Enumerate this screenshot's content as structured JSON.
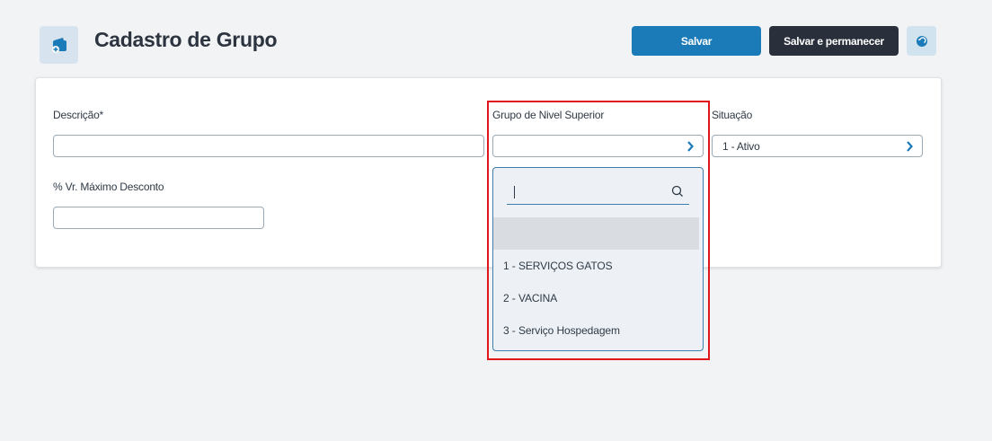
{
  "header": {
    "title": "Cadastro de Grupo",
    "icon": "wallet-add-icon",
    "save_label": "Salvar",
    "save_stay_label": "Salvar e permanecer",
    "back_icon": "undo-icon"
  },
  "form": {
    "descricao": {
      "label": "Descrição*",
      "value": ""
    },
    "grupo_superior": {
      "label": "Grupo de Nivel Superior",
      "value": ""
    },
    "situacao": {
      "label": "Situação",
      "value": "1 - Ativo"
    },
    "desconto": {
      "label": "% Vr. Máximo Desconto",
      "value": ""
    }
  },
  "dropdown": {
    "search_value": "",
    "options": [
      "1 - SERVIÇOS GATOS",
      "2 - VACINA",
      "3 - Serviço Hospedagem"
    ]
  },
  "colors": {
    "primary": "#1b7bb8",
    "dark": "#2a2f3c",
    "highlight": "#e0161b"
  }
}
